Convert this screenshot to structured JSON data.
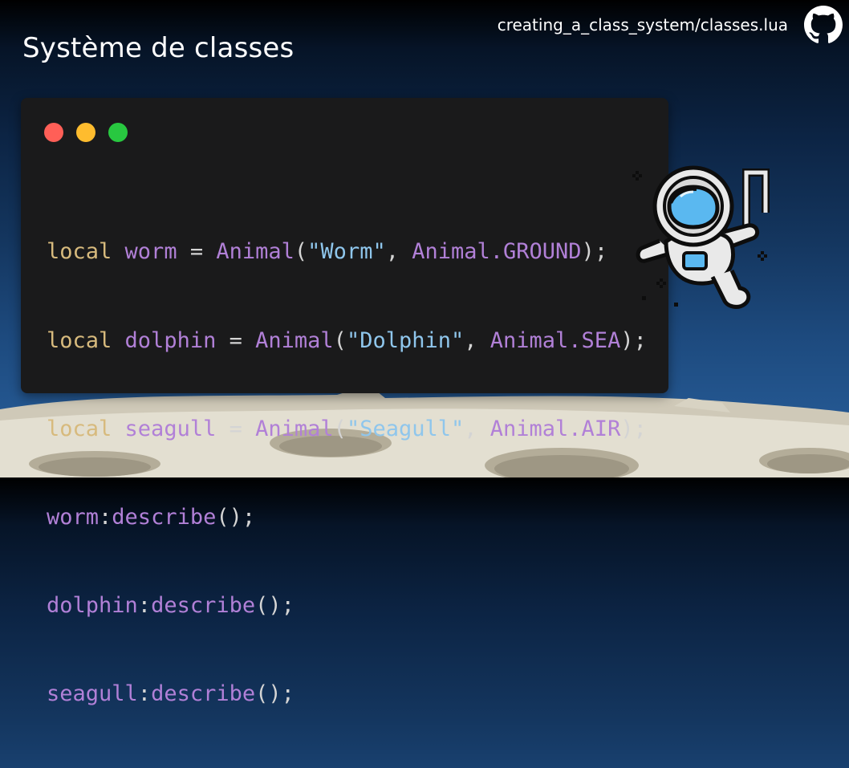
{
  "slide": {
    "title": "Système de classes",
    "file_path": "creating_a_class_system/classes.lua",
    "github_icon": "github-icon"
  },
  "colors": {
    "background_top": "#000000",
    "background_bottom": "#2a62a0",
    "code_bg": "#1a1a1b",
    "keyword": "#d7ba7d",
    "identifier": "#b180d7",
    "string": "#8fc6ec",
    "punctuation": "#d4d4d4",
    "dot_red": "#ff5f57",
    "dot_yellow": "#febc2e",
    "dot_green": "#28c840"
  },
  "code": {
    "line1": {
      "kw": "local",
      "var": "worm",
      "op1": " = ",
      "cls": "Animal",
      "p1": "(",
      "str": "\"Worm\"",
      "p2": ", ",
      "arg": "Animal.GROUND",
      "p3": ");"
    },
    "line2": {
      "kw": "local",
      "var": "dolphin",
      "op1": " = ",
      "cls": "Animal",
      "p1": "(",
      "str": "\"Dolphin\"",
      "p2": ", ",
      "arg": "Animal.SEA",
      "p3": ");"
    },
    "line3": {
      "kw": "local",
      "var": "seagull",
      "op1": " = ",
      "cls": "Animal",
      "p1": "(",
      "str": "\"Seagull\"",
      "p2": ", ",
      "arg": "Animal.AIR",
      "p3": ");"
    },
    "line4": {
      "obj": "worm",
      "colon": ":",
      "method": "describe",
      "call": "();"
    },
    "line5": {
      "obj": "dolphin",
      "colon": ":",
      "method": "describe",
      "call": "();"
    },
    "line6": {
      "obj": "seagull",
      "colon": ":",
      "method": "describe",
      "call": "();"
    }
  },
  "illustrations": {
    "astronaut": "astronaut-illustration",
    "moon": "moon-surface-illustration"
  }
}
